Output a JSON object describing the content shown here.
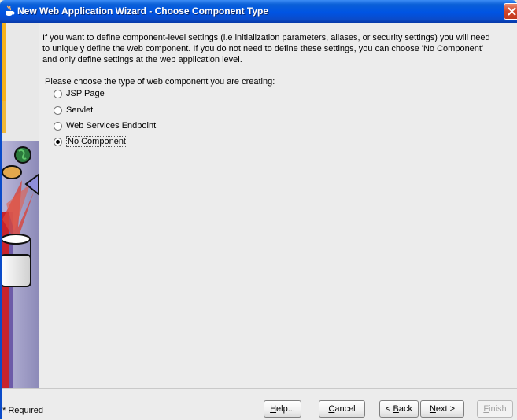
{
  "window": {
    "title": "New Web Application Wizard - Choose Component Type",
    "close_glyph": "close-icon"
  },
  "main": {
    "intro": "If you want to define component-level settings (i.e initialization parameters, aliases, or security settings) you will need to uniquely define the web component.  If you do not need to define these settings, you can choose 'No Component' and only define settings at the web application level.",
    "prompt": "Please choose the type of web component you are creating:",
    "options": [
      {
        "label": "JSP Page",
        "selected": false
      },
      {
        "label": "Servlet",
        "selected": false
      },
      {
        "label": "Web Services Endpoint",
        "selected": false
      },
      {
        "label": "No Component",
        "selected": true
      }
    ]
  },
  "footer": {
    "required_note": "* Required",
    "buttons": {
      "help": {
        "mnemonic": "H",
        "rest": "elp..."
      },
      "cancel": {
        "mnemonic": "C",
        "rest": "ancel"
      },
      "back": {
        "pre": "< ",
        "mnemonic": "B",
        "rest": "ack"
      },
      "next": {
        "mnemonic": "N",
        "rest": "ext >"
      },
      "finish": {
        "mnemonic": "F",
        "rest": "inish"
      }
    }
  },
  "colors": {
    "titlebar": "#0054e3",
    "content_bg": "#ececec"
  }
}
